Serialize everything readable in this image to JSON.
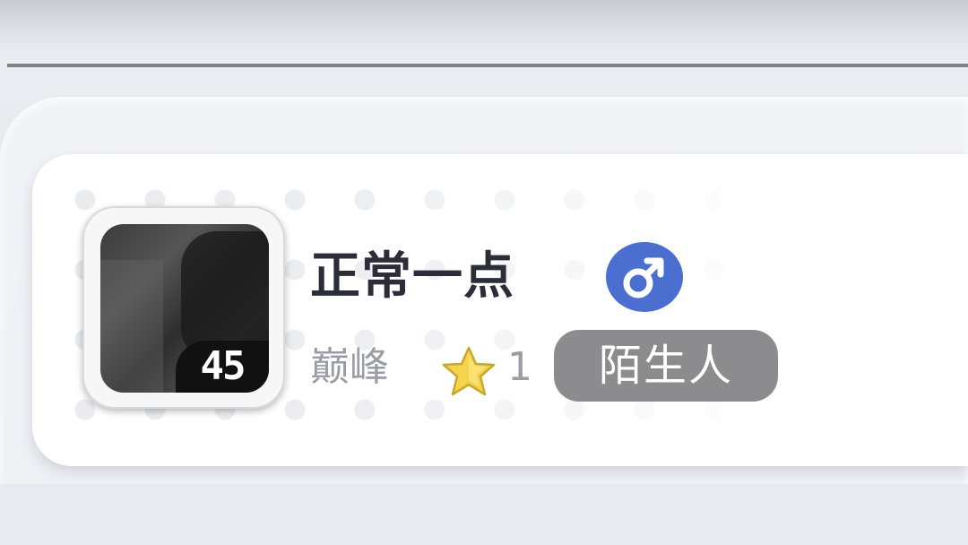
{
  "profile": {
    "name": "正常一点",
    "gender_icon": "male-icon",
    "level": "45",
    "rank_label": "巅峰",
    "star_icon": "star-icon",
    "star_count": "1",
    "relation_label": "陌生人"
  },
  "colors": {
    "gender_badge": "#4a6fd1",
    "relation_tag_bg": "#8c8c8e",
    "name_text": "#2b2e39",
    "secondary_text": "#9a9da6",
    "star_fill": "#f3d44a"
  }
}
